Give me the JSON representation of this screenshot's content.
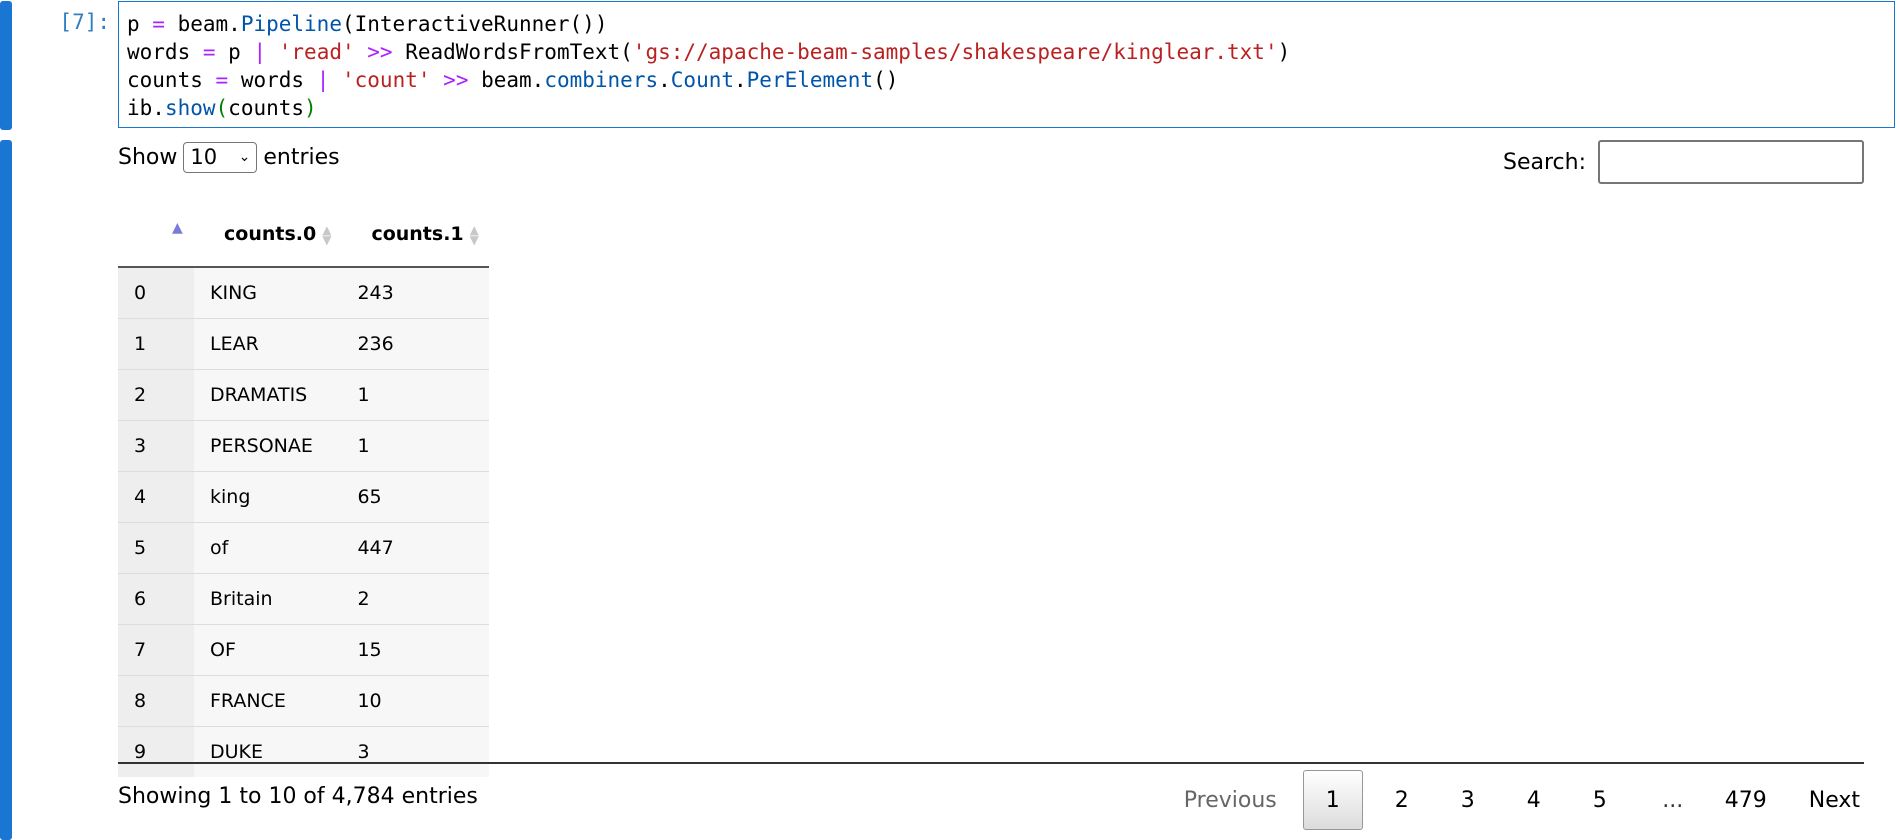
{
  "cell": {
    "prompt": "[7]:",
    "code_lines": [
      [
        {
          "t": "p ",
          "c": ""
        },
        {
          "t": "=",
          "c": "op"
        },
        {
          "t": " beam.",
          "c": ""
        },
        {
          "t": "Pipeline",
          "c": "attr"
        },
        {
          "t": "(InteractiveRunner())",
          "c": ""
        }
      ],
      [
        {
          "t": "words ",
          "c": ""
        },
        {
          "t": "=",
          "c": "op"
        },
        {
          "t": " p ",
          "c": ""
        },
        {
          "t": "|",
          "c": "op"
        },
        {
          "t": " ",
          "c": ""
        },
        {
          "t": "'read'",
          "c": "str"
        },
        {
          "t": " ",
          "c": ""
        },
        {
          "t": ">>",
          "c": "op"
        },
        {
          "t": " ReadWordsFromText(",
          "c": ""
        },
        {
          "t": "'gs://apache-beam-samples/shakespeare/kinglear.txt'",
          "c": "str"
        },
        {
          "t": ")",
          "c": ""
        }
      ],
      [
        {
          "t": "counts ",
          "c": ""
        },
        {
          "t": "=",
          "c": "op"
        },
        {
          "t": " words ",
          "c": ""
        },
        {
          "t": "|",
          "c": "op"
        },
        {
          "t": " ",
          "c": ""
        },
        {
          "t": "'count'",
          "c": "str"
        },
        {
          "t": " ",
          "c": ""
        },
        {
          "t": ">>",
          "c": "op"
        },
        {
          "t": " beam.",
          "c": ""
        },
        {
          "t": "combiners",
          "c": "attr"
        },
        {
          "t": ".",
          "c": ""
        },
        {
          "t": "Count",
          "c": "attr"
        },
        {
          "t": ".",
          "c": ""
        },
        {
          "t": "PerElement",
          "c": "attr"
        },
        {
          "t": "()",
          "c": ""
        }
      ],
      [
        {
          "t": "ib.",
          "c": ""
        },
        {
          "t": "show",
          "c": "attr"
        },
        {
          "t": "(",
          "c": "par"
        },
        {
          "t": "counts",
          "c": ""
        },
        {
          "t": ")",
          "c": "par"
        }
      ]
    ]
  },
  "length": {
    "prefix": "Show",
    "selected": "10",
    "suffix": "entries"
  },
  "search": {
    "label": "Search:",
    "value": ""
  },
  "table": {
    "columns": [
      "",
      "counts.0",
      "counts.1"
    ],
    "rows": [
      [
        "0",
        "KING",
        "243"
      ],
      [
        "1",
        "LEAR",
        "236"
      ],
      [
        "2",
        "DRAMATIS",
        "1"
      ],
      [
        "3",
        "PERSONAE",
        "1"
      ],
      [
        "4",
        "king",
        "65"
      ],
      [
        "5",
        "of",
        "447"
      ],
      [
        "6",
        "Britain",
        "2"
      ],
      [
        "7",
        "OF",
        "15"
      ],
      [
        "8",
        "FRANCE",
        "10"
      ],
      [
        "9",
        "DUKE",
        "3"
      ]
    ]
  },
  "info": "Showing 1 to 10 of 4,784 entries",
  "pager": {
    "previous": "Previous",
    "current": "1",
    "pages": [
      "2",
      "3",
      "4",
      "5"
    ],
    "ellipsis": "...",
    "last": "479",
    "next": "Next"
  },
  "colors": {
    "accent": "#1976d2",
    "prompt": "#307fc1",
    "string": "#ba2121",
    "operator": "#aa22ff",
    "attribute": "#0055aa"
  }
}
